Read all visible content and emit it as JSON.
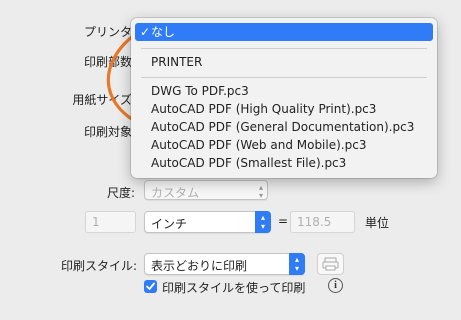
{
  "labels": {
    "printer": "プリンタ",
    "copies": "印刷部数",
    "paper_size": "用紙サイズ",
    "print_target": "印刷対象",
    "scale": "尺度:",
    "print_style": "印刷スタイル:"
  },
  "printer_menu": {
    "items": [
      {
        "label": "なし",
        "selected": true
      },
      {
        "label": "PRINTER",
        "selected": false
      },
      {
        "label": "DWG To PDF.pc3",
        "selected": false
      },
      {
        "label": "AutoCAD PDF (High Quality Print).pc3",
        "selected": false
      },
      {
        "label": "AutoCAD PDF (General Documentation).pc3",
        "selected": false
      },
      {
        "label": "AutoCAD PDF (Web and Mobile).pc3",
        "selected": false
      },
      {
        "label": "AutoCAD PDF (Smallest File).pc3",
        "selected": false
      }
    ]
  },
  "scale": {
    "value": "カスタム",
    "units_value": "1",
    "unit_select": "インチ",
    "equals": "=",
    "drawing_units_value": "118.5",
    "drawing_units_label": "単位"
  },
  "print_style": {
    "value": "表示どおりに印刷",
    "checkbox_label": "印刷スタイルを使って印刷",
    "checkbox_checked": true
  },
  "colors": {
    "accent": "#2f7cf6",
    "arrow": "#e8782a"
  }
}
